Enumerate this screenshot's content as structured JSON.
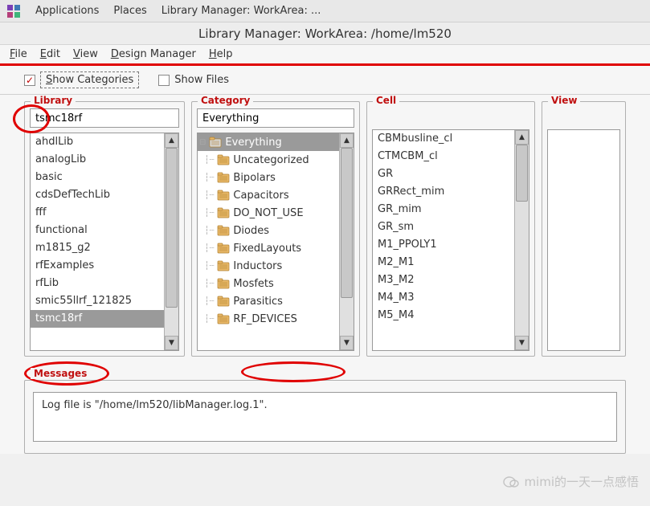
{
  "topbar": {
    "applications": "Applications",
    "places": "Places",
    "window_switch": "Library Manager: WorkArea: ..."
  },
  "window_title": "Library Manager: WorkArea: /home/lm520",
  "menus": {
    "file": "File",
    "edit": "Edit",
    "view": "View",
    "design_manager": "Design Manager",
    "help": "Help"
  },
  "checks": {
    "show_categories": "Show Categories",
    "show_files": "Show Files"
  },
  "panels": {
    "library": {
      "title": "Library",
      "input_value": "tsmc18rf",
      "items": [
        "ahdlLib",
        "analogLib",
        "basic",
        "cdsDefTechLib",
        "fff",
        "functional",
        "m1815_g2",
        "rfExamples",
        "rfLib",
        "smic55llrf_121825",
        "tsmc18rf"
      ],
      "selected_index": 10
    },
    "category": {
      "title": "Category",
      "input_value": "Everything",
      "items": [
        "Everything",
        "Uncategorized",
        "Bipolars",
        "Capacitors",
        "DO_NOT_USE",
        "Diodes",
        "FixedLayouts",
        "Inductors",
        "Mosfets",
        "Parasitics",
        "RF_DEVICES"
      ],
      "selected_index": 0
    },
    "cell": {
      "title": "Cell",
      "items": [
        "CBMbusline_cl",
        "CTMCBM_cl",
        "GR",
        "GRRect_mim",
        "GR_mim",
        "GR_sm",
        "M1_PPOLY1",
        "M2_M1",
        "M3_M2",
        "M4_M3",
        "M5_M4"
      ]
    },
    "view": {
      "title": "View"
    }
  },
  "messages": {
    "title": "Messages",
    "log": "Log file is \"/home/lm520/libManager.log.1\"."
  },
  "watermark": "mimi的一天一点感悟"
}
